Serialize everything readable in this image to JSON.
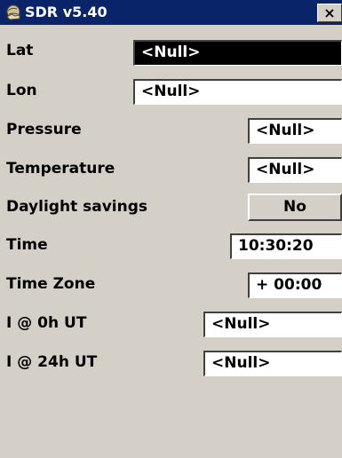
{
  "window": {
    "title": "SDR v5.40",
    "close_glyph": "×",
    "app_icon": "globe-hand-icon"
  },
  "fields": {
    "lat": {
      "label": "Lat",
      "value": "<Null>"
    },
    "lon": {
      "label": "Lon",
      "value": "<Null>"
    },
    "pressure": {
      "label": "Pressure",
      "value": "<Null>"
    },
    "temperature": {
      "label": "Temperature",
      "value": "<Null>"
    },
    "daylight_savings": {
      "label": "Daylight savings",
      "value": "No"
    },
    "time": {
      "label": "Time",
      "value": "10:30:20"
    },
    "time_zone": {
      "label": "Time Zone",
      "value": "+ 00:00"
    },
    "i_0h_ut": {
      "label": "I @ 0h UT",
      "value": "<Null>"
    },
    "i_24h_ut": {
      "label": "I @ 24h UT",
      "value": "<Null>"
    }
  },
  "colors": {
    "titlebar": "#0a246a",
    "face": "#d4d0c8",
    "selected_field": "#000000"
  }
}
